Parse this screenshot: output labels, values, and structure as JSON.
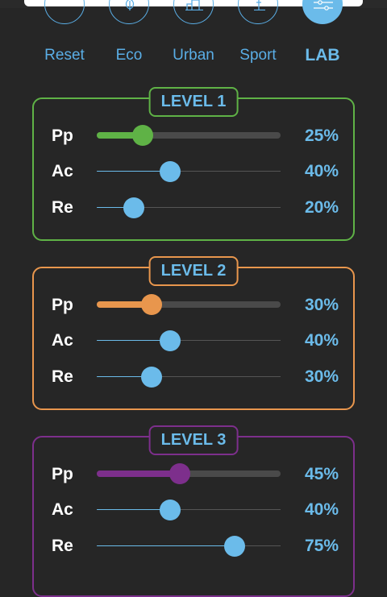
{
  "modes": [
    {
      "label": "Reset",
      "icon": "reset-icon",
      "active": false
    },
    {
      "label": "Eco",
      "icon": "leaf-icon",
      "active": false
    },
    {
      "label": "Urban",
      "icon": "building-icon",
      "active": false
    },
    {
      "label": "Sport",
      "icon": "sport-icon",
      "active": false
    },
    {
      "label": "LAB",
      "icon": "sliders-icon",
      "active": true
    }
  ],
  "colors": {
    "level1": "#5fb246",
    "level2": "#e8964d",
    "level3": "#7d2f8c",
    "accent": "#6bbbea",
    "background": "#262626"
  },
  "levels": [
    {
      "title": "LEVEL 1",
      "rows": [
        {
          "name": "Pp",
          "value": "25%",
          "fraction": 0.25
        },
        {
          "name": "Ac",
          "value": "40%",
          "fraction": 0.4
        },
        {
          "name": "Re",
          "value": "20%",
          "fraction": 0.2
        }
      ]
    },
    {
      "title": "LEVEL 2",
      "rows": [
        {
          "name": "Pp",
          "value": "30%",
          "fraction": 0.3
        },
        {
          "name": "Ac",
          "value": "40%",
          "fraction": 0.4
        },
        {
          "name": "Re",
          "value": "30%",
          "fraction": 0.3
        }
      ]
    },
    {
      "title": "LEVEL 3",
      "rows": [
        {
          "name": "Pp",
          "value": "45%",
          "fraction": 0.45
        },
        {
          "name": "Ac",
          "value": "40%",
          "fraction": 0.4
        },
        {
          "name": "Re",
          "value": "75%",
          "fraction": 0.75
        }
      ]
    }
  ]
}
